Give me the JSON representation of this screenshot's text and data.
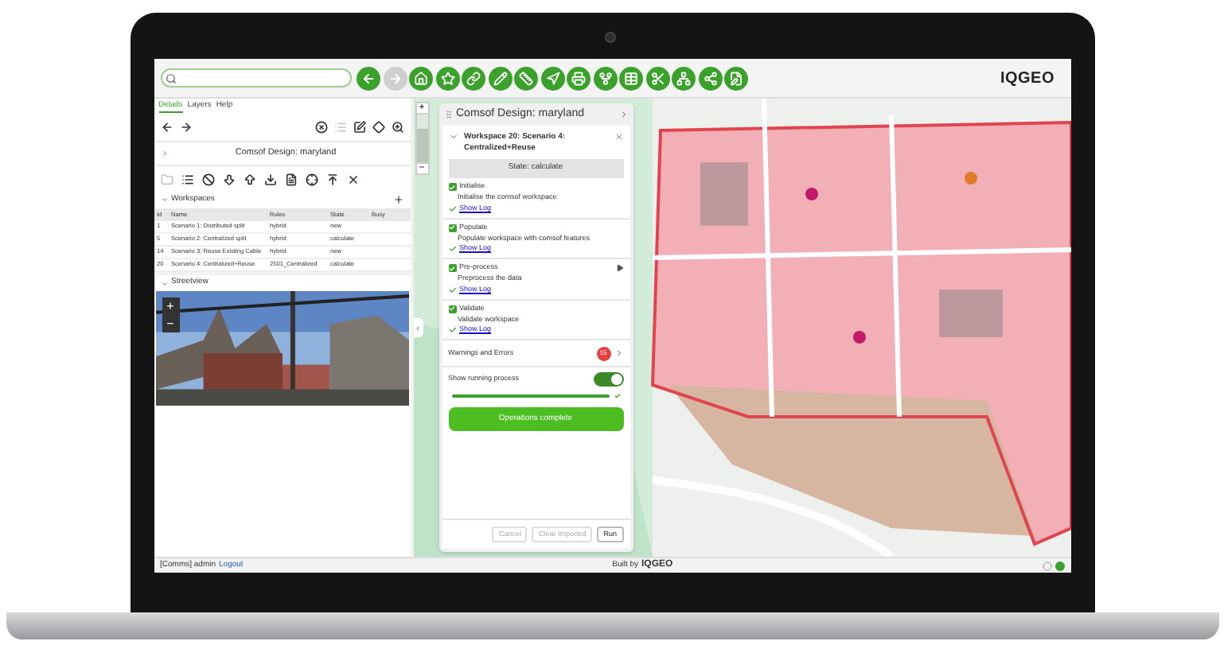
{
  "toolbar": [
    {
      "kind": "back",
      "disabled": false
    },
    {
      "kind": "forward",
      "disabled": true
    },
    {
      "kind": "home",
      "disabled": false
    },
    {
      "kind": "star",
      "disabled": false
    },
    {
      "kind": "link",
      "disabled": false
    },
    {
      "kind": "pencil",
      "disabled": false
    },
    {
      "kind": "ruler",
      "disabled": false
    },
    {
      "kind": "navigate",
      "disabled": false
    },
    {
      "kind": "print",
      "disabled": false
    },
    {
      "kind": "fork",
      "disabled": false
    },
    {
      "kind": "table",
      "disabled": false
    },
    {
      "kind": "scissors",
      "disabled": false
    },
    {
      "kind": "nodes",
      "disabled": false
    },
    {
      "kind": "share",
      "disabled": false
    },
    {
      "kind": "note",
      "disabled": false
    }
  ],
  "logo": "IQGEO",
  "tabs": [
    {
      "label": "Details",
      "selected": true
    },
    {
      "label": "Layers",
      "selected": false
    },
    {
      "label": "Help",
      "selected": false
    }
  ],
  "detail_tools": [
    {
      "kind": "back",
      "disabled": false
    },
    {
      "kind": "forward",
      "disabled": false
    },
    {
      "kind": "clear",
      "disabled": false
    },
    {
      "kind": "list",
      "disabled": true
    },
    {
      "kind": "edit",
      "disabled": false
    },
    {
      "kind": "diamond",
      "disabled": false
    },
    {
      "kind": "zoom",
      "disabled": false
    }
  ],
  "detail_title": "Comsof Design: maryland",
  "design_tools": [
    {
      "kind": "folder",
      "disabled": true
    },
    {
      "kind": "list",
      "disabled": false
    },
    {
      "kind": "ban",
      "disabled": false
    },
    {
      "kind": "down",
      "disabled": false
    },
    {
      "kind": "up",
      "disabled": false
    },
    {
      "kind": "download",
      "disabled": false
    },
    {
      "kind": "doc",
      "disabled": false
    },
    {
      "kind": "crosshair",
      "disabled": false
    },
    {
      "kind": "top",
      "disabled": false
    },
    {
      "kind": "close",
      "disabled": false
    }
  ],
  "workspaces": {
    "title": "Workspaces",
    "expanded": true,
    "columns": [
      "Id",
      "Name",
      "Rules",
      "State",
      "Busy"
    ],
    "rows": [
      [
        "1",
        "Scenario 1: Distributed split",
        "hybrid",
        "new"
      ],
      [
        "5",
        "Scenario 2: Centralized split",
        "hybrid",
        "calculate"
      ],
      [
        "14",
        "Scenario 3: Reuse Existing Cable",
        "hybrid",
        "new"
      ],
      [
        "20",
        "Scenario 4: Centralized+Reuse",
        "2501_Centralized",
        "calculate"
      ]
    ]
  },
  "streetview": {
    "title": "Streetview",
    "expanded": true,
    "zoom_in": "+",
    "zoom_out": "−"
  },
  "map_zoom": {
    "zoom_in": "+",
    "zoom_out": "−",
    "level": 0.7
  },
  "panel": {
    "title": "Comsof Design: maryland",
    "workspace": "Workspace 20: Scenario 4: Centralized+Reuse",
    "state": "State: calculate",
    "steps": [
      {
        "name": "Initialise",
        "description": "Initialise the comsof workspace",
        "checked": true,
        "done": true,
        "current": false,
        "log": "Show Log"
      },
      {
        "name": "Populate",
        "description": "Populate workspace with comsof features",
        "checked": true,
        "done": true,
        "current": false,
        "log": "Show Log"
      },
      {
        "name": "Pre-process",
        "description": "Preprocess the data",
        "checked": true,
        "done": true,
        "current": true,
        "log": "Show Log"
      },
      {
        "name": "Validate",
        "description": "Validate workspace",
        "checked": true,
        "done": true,
        "current": false,
        "log": "Show Log"
      }
    ],
    "warnings": {
      "label": "Warnings and Errors",
      "count": "15"
    },
    "running": {
      "label": "Show running process",
      "on": true,
      "level": 1
    },
    "complete": "Operations complete",
    "buttons": [
      {
        "label": "Cancel",
        "disabled": true
      },
      {
        "label": "Clear Imported",
        "disabled": true
      },
      {
        "label": "Run",
        "disabled": false
      }
    ]
  },
  "status_bar": {
    "user": "[Comms] admin",
    "logout": "Logout",
    "built_by": "Built by",
    "brand": "IQGEO"
  }
}
